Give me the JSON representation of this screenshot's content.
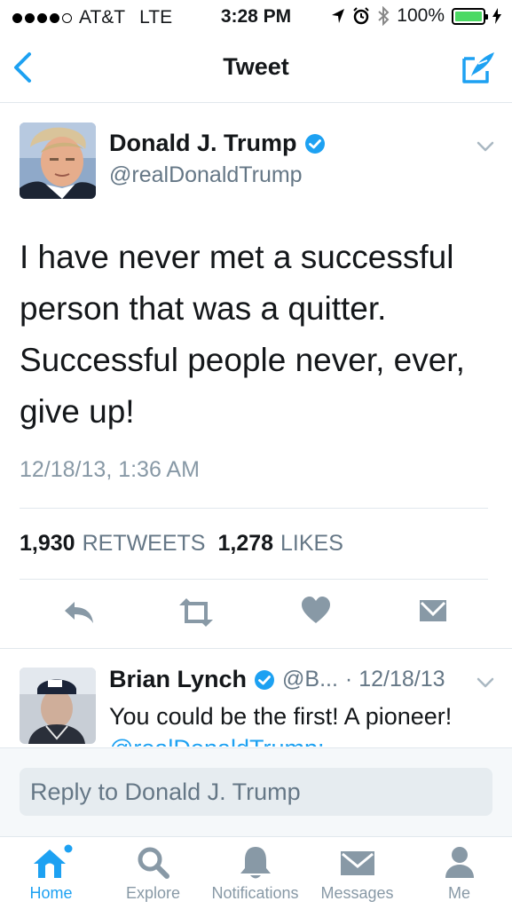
{
  "status_bar": {
    "carrier": "AT&T",
    "network": "LTE",
    "time": "3:28 PM",
    "battery": "100%"
  },
  "nav": {
    "title": "Tweet",
    "back_icon": "chevron-left-icon",
    "compose_icon": "compose-tweet-icon"
  },
  "tweet": {
    "author_name": "Donald J. Trump",
    "author_handle": "@realDonaldTrump",
    "verified": true,
    "text": "I have never met a successful person that was a quitter. Successful people never, ever, give up!",
    "timestamp": "12/18/13, 1:36 AM",
    "retweets_count": "1,930",
    "retweets_label": "RETWEETS",
    "likes_count": "1,278",
    "likes_label": "LIKES"
  },
  "actions": [
    "reply-icon",
    "retweet-icon",
    "like-icon",
    "direct-message-icon"
  ],
  "reply_preview": {
    "author_name": "Brian Lynch",
    "verified": true,
    "handle": "@B...",
    "date": "· 12/18/13",
    "text": "You could be the first! A pioneer! ",
    "mention": "@realDonaldTrump:"
  },
  "reply_box": {
    "placeholder": "Reply to Donald J. Trump"
  },
  "tabs": [
    {
      "label": "Home",
      "icon": "home-icon",
      "active": true
    },
    {
      "label": "Explore",
      "icon": "search-icon",
      "active": false
    },
    {
      "label": "Notifications",
      "icon": "bell-icon",
      "active": false
    },
    {
      "label": "Messages",
      "icon": "envelope-icon",
      "active": false
    },
    {
      "label": "Me",
      "icon": "person-icon",
      "active": false
    }
  ],
  "colors": {
    "accent": "#1da1f2",
    "text_primary": "#14171a",
    "text_secondary": "#657786",
    "icon_gray": "#8899a6",
    "battery_green": "#4cd964"
  }
}
